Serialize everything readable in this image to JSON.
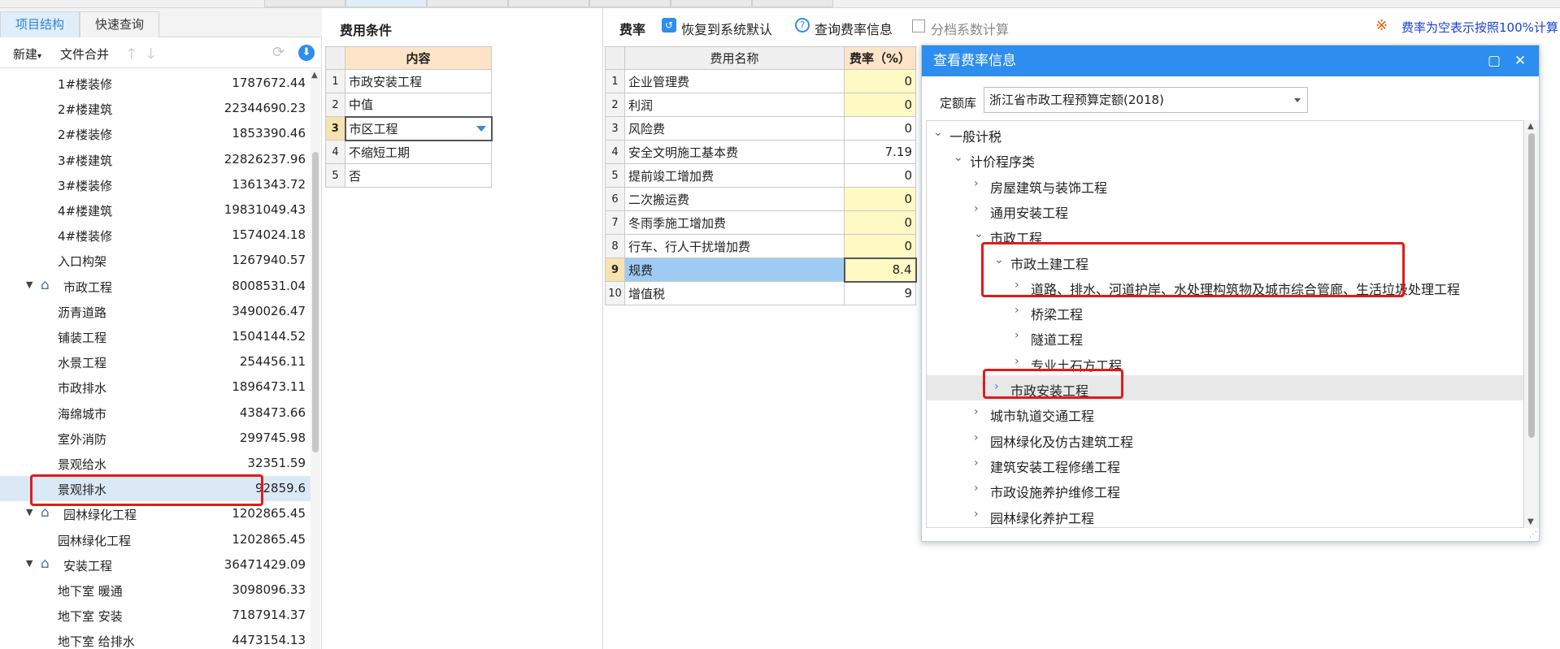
{
  "left": {
    "tabs": [
      "项目结构",
      "快速查询"
    ],
    "toolbar": {
      "new": "新建",
      "merge": "文件合并"
    },
    "tree": [
      {
        "label": "1#楼装修",
        "value": "1787672.44",
        "level": 2
      },
      {
        "label": "2#楼建筑",
        "value": "22344690.23",
        "level": 2
      },
      {
        "label": "2#楼装修",
        "value": "1853390.46",
        "level": 2
      },
      {
        "label": "3#楼建筑",
        "value": "22826237.96",
        "level": 2
      },
      {
        "label": "3#楼装修",
        "value": "1361343.72",
        "level": 2
      },
      {
        "label": "4#楼建筑",
        "value": "19831049.43",
        "level": 2
      },
      {
        "label": "4#楼装修",
        "value": "1574024.18",
        "level": 2
      },
      {
        "label": "入口构架",
        "value": "1267940.57",
        "level": 2
      },
      {
        "label": "市政工程",
        "value": "8008531.04",
        "level": 1
      },
      {
        "label": "沥青道路",
        "value": "3490026.47",
        "level": 2
      },
      {
        "label": "铺装工程",
        "value": "1504144.52",
        "level": 2
      },
      {
        "label": "水景工程",
        "value": "254456.11",
        "level": 2
      },
      {
        "label": "市政排水",
        "value": "1896473.11",
        "level": 2
      },
      {
        "label": "海绵城市",
        "value": "438473.66",
        "level": 2
      },
      {
        "label": "室外消防",
        "value": "299745.98",
        "level": 2
      },
      {
        "label": "景观给水",
        "value": "32351.59",
        "level": 2
      },
      {
        "label": "景观排水",
        "value": "92859.6",
        "level": 2,
        "selected": true
      },
      {
        "label": "园林绿化工程",
        "value": "1202865.45",
        "level": 1
      },
      {
        "label": "园林绿化工程",
        "value": "1202865.45",
        "level": 2
      },
      {
        "label": "安装工程",
        "value": "36471429.09",
        "level": 1
      },
      {
        "label": "地下室 暖通",
        "value": "3098096.33",
        "level": 2
      },
      {
        "label": "地下室 安装",
        "value": "7187914.37",
        "level": 2
      },
      {
        "label": "地下室 给排水",
        "value": "4473154.13",
        "level": 2
      }
    ]
  },
  "mid": {
    "title": "费用条件",
    "header": "内容",
    "rows": [
      "市政安装工程",
      "中值",
      "市区工程",
      "不缩短工期",
      "否"
    ],
    "selected_index": 2
  },
  "right": {
    "toolbar": {
      "label": "费率",
      "restore": "恢复到系统默认",
      "query": "查询费率信息",
      "tiered": "分档系数计算",
      "note": "费率为空表示按照100%计算",
      "note_mark": "※"
    },
    "table": {
      "name_header": "费用名称",
      "rate_header": "费率（%）",
      "rows": [
        {
          "name": "企业管理费",
          "rate": "0",
          "yellow": true
        },
        {
          "name": "利润",
          "rate": "0",
          "yellow": true
        },
        {
          "name": "风险费",
          "rate": "0",
          "yellow": false
        },
        {
          "name": "安全文明施工基本费",
          "rate": "7.19",
          "yellow": false
        },
        {
          "name": "提前竣工增加费",
          "rate": "0",
          "yellow": false
        },
        {
          "name": "二次搬运费",
          "rate": "0",
          "yellow": true
        },
        {
          "name": "冬雨季施工增加费",
          "rate": "0",
          "yellow": true
        },
        {
          "name": "行车、行人干扰增加费",
          "rate": "0",
          "yellow": true
        },
        {
          "name": "规费",
          "rate": "8.4",
          "yellow": true,
          "selected": true
        },
        {
          "name": "增值税",
          "rate": "9",
          "yellow": false
        }
      ]
    }
  },
  "dialog": {
    "title": "查看费率信息",
    "quota_label": "定额库",
    "quota_value": "浙江省市政工程预算定额(2018)",
    "tree": [
      {
        "label": "一般计税",
        "depth": 0,
        "expanded": true
      },
      {
        "label": "计价程序类",
        "depth": 1,
        "expanded": true
      },
      {
        "label": "房屋建筑与装饰工程",
        "depth": 2,
        "expanded": false
      },
      {
        "label": "通用安装工程",
        "depth": 2,
        "expanded": false
      },
      {
        "label": "市政工程",
        "depth": 2,
        "expanded": true
      },
      {
        "label": "市政土建工程",
        "depth": 3,
        "expanded": true
      },
      {
        "label": "道路、排水、河道护岸、水处理构筑物及城市综合管廊、生活垃圾处理工程",
        "depth": 4,
        "expanded": false
      },
      {
        "label": "桥梁工程",
        "depth": 4,
        "expanded": false
      },
      {
        "label": "隧道工程",
        "depth": 4,
        "expanded": false
      },
      {
        "label": "专业土石方工程",
        "depth": 4,
        "expanded": false
      },
      {
        "label": "市政安装工程",
        "depth": 3,
        "expanded": false,
        "highlight": true
      },
      {
        "label": "城市轨道交通工程",
        "depth": 2,
        "expanded": false
      },
      {
        "label": "园林绿化及仿古建筑工程",
        "depth": 2,
        "expanded": false
      },
      {
        "label": "建筑安装工程修缮工程",
        "depth": 2,
        "expanded": false
      },
      {
        "label": "市政设施养护维修工程",
        "depth": 2,
        "expanded": false
      },
      {
        "label": "园林绿化养护工程",
        "depth": 2,
        "expanded": false
      }
    ]
  },
  "colors": {
    "accent": "#2d8ef0",
    "highlight_red": "#e21b1b",
    "header_orange": "#fde4c8",
    "cell_yellow": "#fff9c4",
    "row_selected": "#9ecbf3"
  }
}
